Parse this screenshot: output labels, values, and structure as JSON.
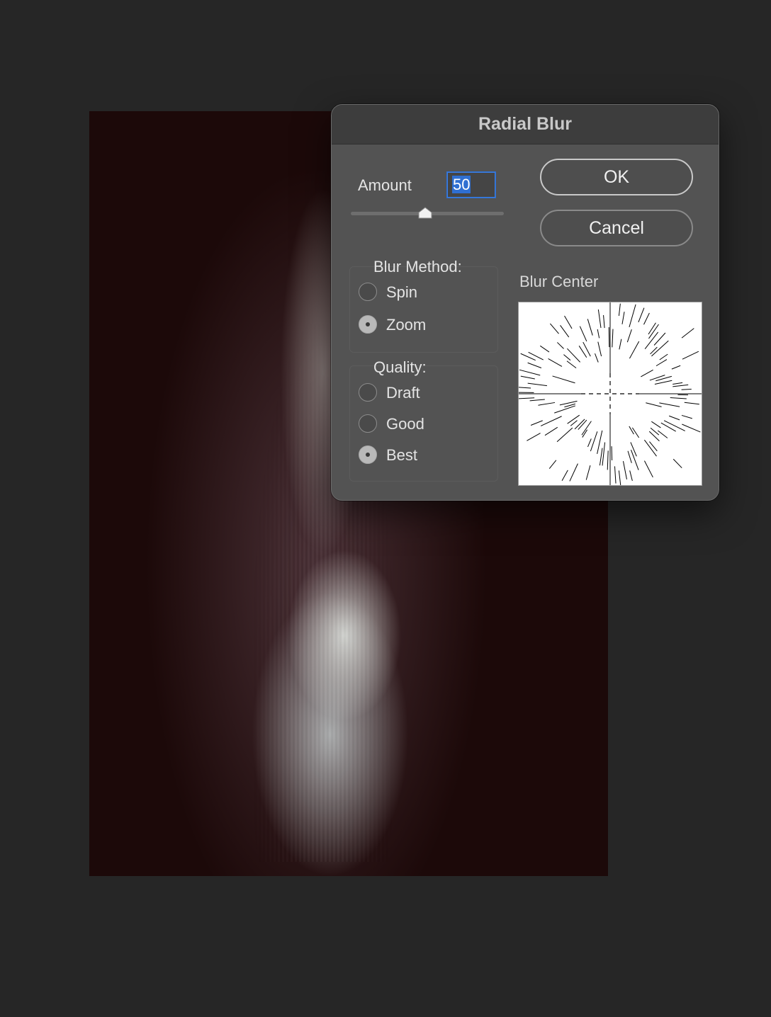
{
  "dialog": {
    "title": "Radial Blur",
    "amount_label": "Amount",
    "amount_value": "50",
    "amount_slider_fraction": 0.5,
    "blur_method": {
      "title": "Blur Method:",
      "options": [
        "Spin",
        "Zoom"
      ],
      "selected": "Zoom"
    },
    "quality": {
      "title": "Quality:",
      "options": [
        "Draft",
        "Good",
        "Best"
      ],
      "selected": "Best"
    },
    "buttons": {
      "ok": "OK",
      "cancel": "Cancel"
    },
    "blur_center_label": "Blur Center"
  },
  "colors": {
    "app_background": "#262626",
    "dialog_background": "#535353",
    "titlebar": "#3d3d3d",
    "focus_blue": "#3b7ee2"
  }
}
